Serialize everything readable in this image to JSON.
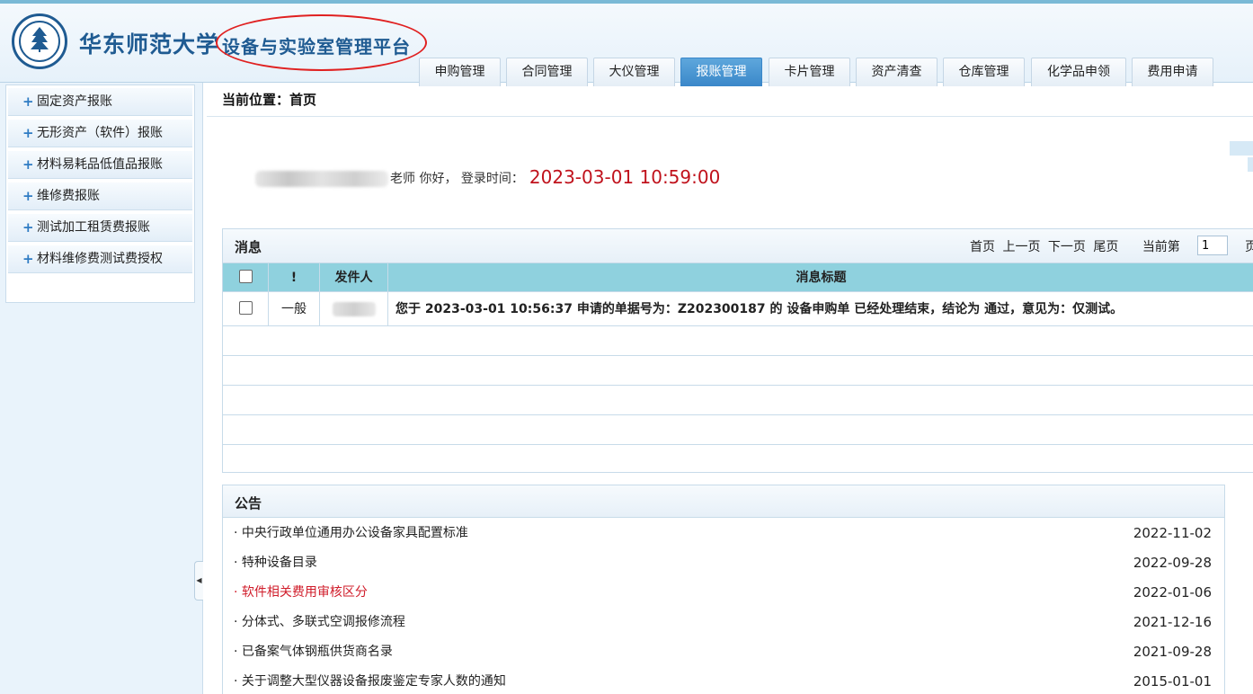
{
  "header": {
    "school_name": "华东师范大学",
    "platform_name": "设备与实验室管理平台",
    "logo_icon": "university-seal-icon",
    "tabs": [
      {
        "label": "申购管理",
        "active": false
      },
      {
        "label": "合同管理",
        "active": false
      },
      {
        "label": "大仪管理",
        "active": false
      },
      {
        "label": "报账管理",
        "active": true
      },
      {
        "label": "卡片管理",
        "active": false
      },
      {
        "label": "资产清查",
        "active": false
      },
      {
        "label": "仓库管理",
        "active": false
      },
      {
        "label": "化学品申领",
        "active": false
      },
      {
        "label": "费用申请",
        "active": false
      }
    ]
  },
  "sidebar": {
    "items": [
      {
        "label": "固定资产报账",
        "icon": "plus-icon"
      },
      {
        "label": "无形资产（软件）报账",
        "icon": "plus-icon"
      },
      {
        "label": "材料易耗品低值品报账",
        "icon": "plus-icon"
      },
      {
        "label": "维修费报账",
        "icon": "plus-icon"
      },
      {
        "label": "测试加工租赁费报账",
        "icon": "plus-icon"
      },
      {
        "label": "材料维修费测试费授权",
        "icon": "plus-icon"
      }
    ]
  },
  "breadcrumb": "当前位置：首页",
  "welcome": {
    "greeting": "老师 你好，  登录时间：",
    "login_time": "2023-03-01 10:59:00"
  },
  "messages": {
    "title": "消息",
    "pager": {
      "first": "首页",
      "prev": "上一页",
      "next": "下一页",
      "last": "尾页",
      "current_label": "当前第",
      "current_page": "1",
      "page_suffix": "页"
    },
    "columns": {
      "importance": "!",
      "sender": "发件人",
      "subject": "消息标题"
    },
    "rows": [
      {
        "importance": "一般",
        "subject": "您于 2023-03-01 10:56:37 申请的单据号为：Z202300187 的 设备申购单 已经处理结束，结论为 通过，意见为：仅测试。"
      }
    ]
  },
  "notice": {
    "title": "公告",
    "items": [
      {
        "text": "· 中央行政单位通用办公设备家具配置标准",
        "date": "2022-11-02",
        "highlight": false
      },
      {
        "text": "· 特种设备目录",
        "date": "2022-09-28",
        "highlight": false
      },
      {
        "text": "· 软件相关费用审核区分",
        "date": "2022-01-06",
        "highlight": true
      },
      {
        "text": "· 分体式、多联式空调报修流程",
        "date": "2021-12-16",
        "highlight": false
      },
      {
        "text": "· 已备案气体钢瓶供货商名录",
        "date": "2021-09-28",
        "highlight": false
      },
      {
        "text": "· 关于调整大型仪器设备报废鉴定专家人数的通知",
        "date": "2015-01-01",
        "highlight": false
      }
    ]
  },
  "colors": {
    "brand_blue": "#1f5b92",
    "active_tab": "#3a87c9",
    "table_header": "#8fd1de",
    "login_time": "#c0121c",
    "annotation_ellipse": "#e02020",
    "highlight_notice": "#d01c2a"
  }
}
